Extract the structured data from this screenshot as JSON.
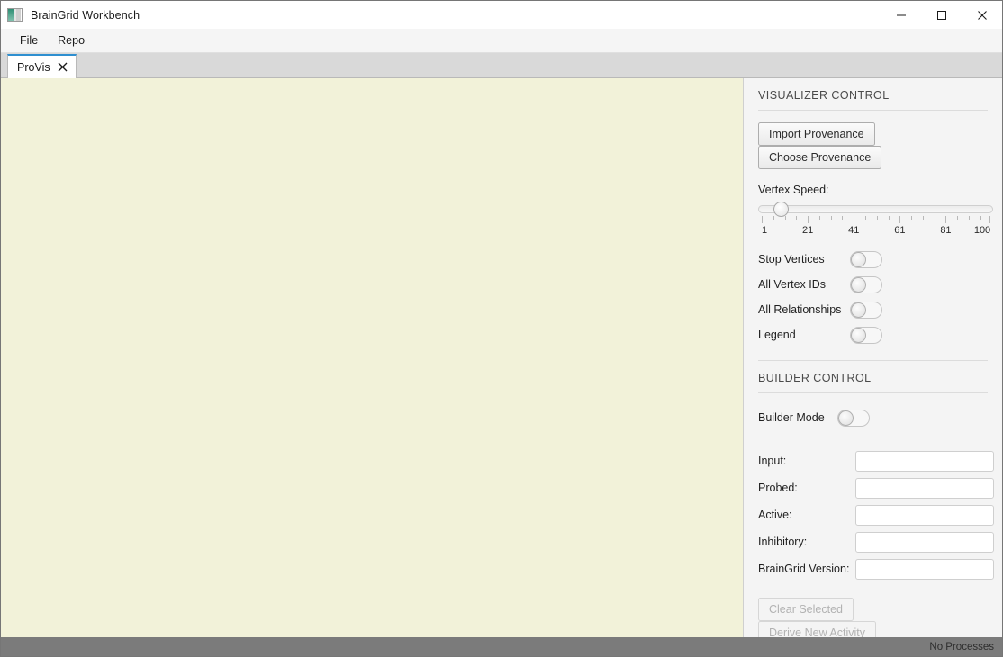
{
  "window": {
    "title": "BrainGrid Workbench",
    "icon": "app-image-icon",
    "controls": {
      "minimize": "minimize-icon",
      "maximize": "maximize-icon",
      "close": "close-icon"
    }
  },
  "menubar": {
    "items": [
      {
        "label": "File"
      },
      {
        "label": "Repo"
      }
    ]
  },
  "tabs": [
    {
      "label": "ProVis",
      "close": "✕",
      "active": true
    }
  ],
  "canvas": {
    "background_color": "#F2F2D9"
  },
  "panel": {
    "visualizer": {
      "title": "VISUALIZER CONTROL",
      "import_button": "Import Provenance",
      "choose_button": "Choose Provenance",
      "slider": {
        "label": "Vertex Speed:",
        "value": 9,
        "min": 1,
        "max": 100,
        "scale_labels": [
          "1",
          "21",
          "41",
          "61",
          "81",
          "100"
        ],
        "scale_values": [
          1,
          21,
          41,
          61,
          81,
          100
        ]
      },
      "toggles": [
        {
          "label": "Stop Vertices",
          "on": false
        },
        {
          "label": "All Vertex IDs",
          "on": false
        },
        {
          "label": "All Relationships",
          "on": false
        },
        {
          "label": "Legend",
          "on": false
        }
      ]
    },
    "builder": {
      "title": "BUILDER CONTROL",
      "mode_toggle": {
        "label": "Builder Mode",
        "on": false
      },
      "fields": [
        {
          "label": "Input:",
          "value": "",
          "placeholder": ""
        },
        {
          "label": "Probed:",
          "value": "",
          "placeholder": ""
        },
        {
          "label": "Active:",
          "value": "",
          "placeholder": ""
        },
        {
          "label": "Inhibitory:",
          "value": "",
          "placeholder": ""
        },
        {
          "label": "BrainGrid Version:",
          "value": "",
          "placeholder": ""
        }
      ],
      "clear_button": {
        "label": "Clear Selected",
        "disabled": true
      },
      "derive_button": {
        "label": "Derive New Activity",
        "disabled": true
      }
    }
  },
  "statusbar": {
    "text": "No Processes"
  },
  "colors": {
    "accent": "#2F8FD0",
    "canvas": "#F2F2D9",
    "panel": "#F4F4F4",
    "statusbar": "#7B7B7B"
  }
}
